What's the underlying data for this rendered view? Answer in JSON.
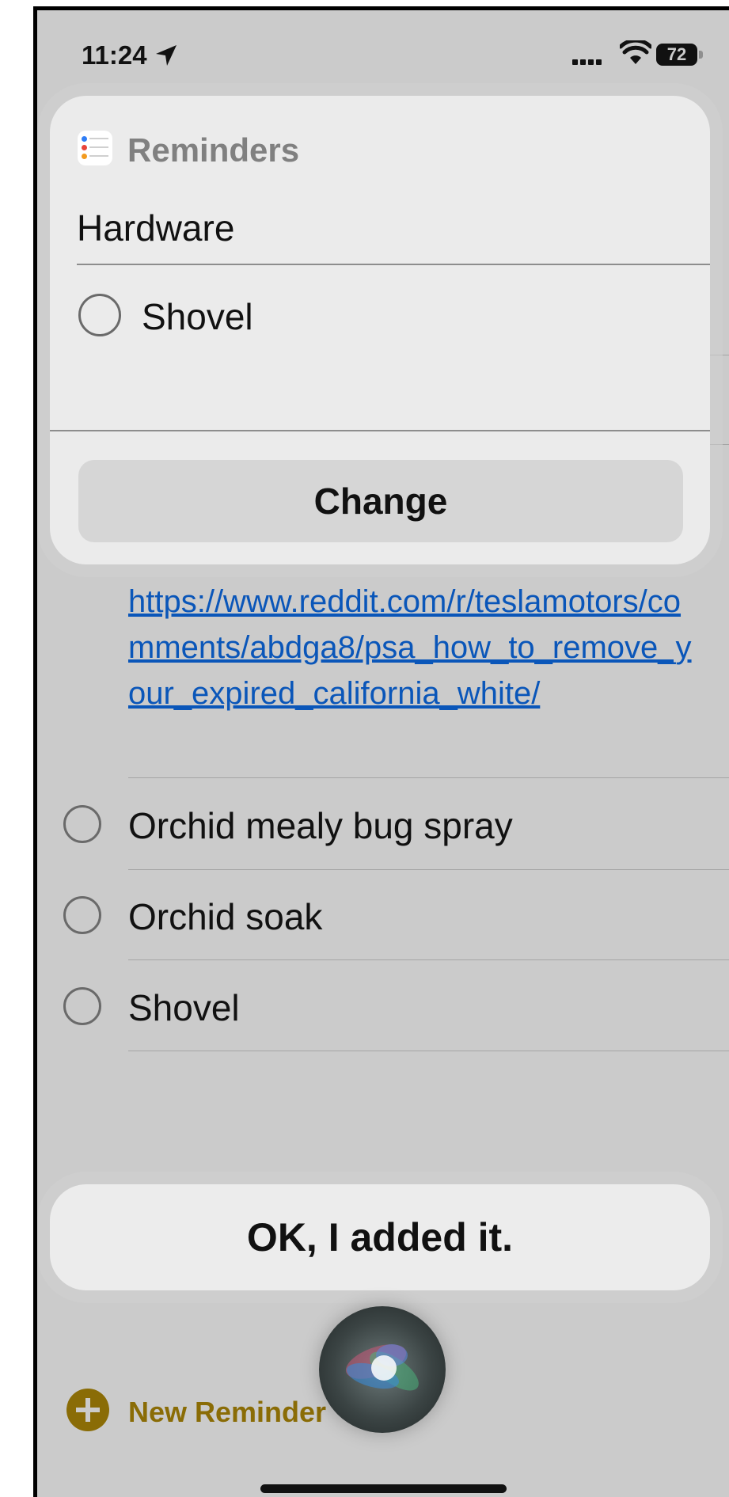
{
  "status_bar": {
    "time": "11:24",
    "battery": "72"
  },
  "siri_card": {
    "app_name": "Reminders",
    "list_name": "Hardware",
    "item": "Shovel",
    "change_label": "Change"
  },
  "reminders": {
    "link": "https://www.reddit.com/r/teslamotors/comments/abdga8/psa_how_to_remove_your_expired_california_white/",
    "items": [
      {
        "label": "Orchid mealy bug spray"
      },
      {
        "label": "Orchid soak"
      },
      {
        "label": "Shovel"
      }
    ],
    "new_reminder_label": "New Reminder"
  },
  "siri_response": "OK, I added it.",
  "colors": {
    "accent": "#8a6c06",
    "link": "#0a56b9",
    "background": "#cbcbcb"
  }
}
